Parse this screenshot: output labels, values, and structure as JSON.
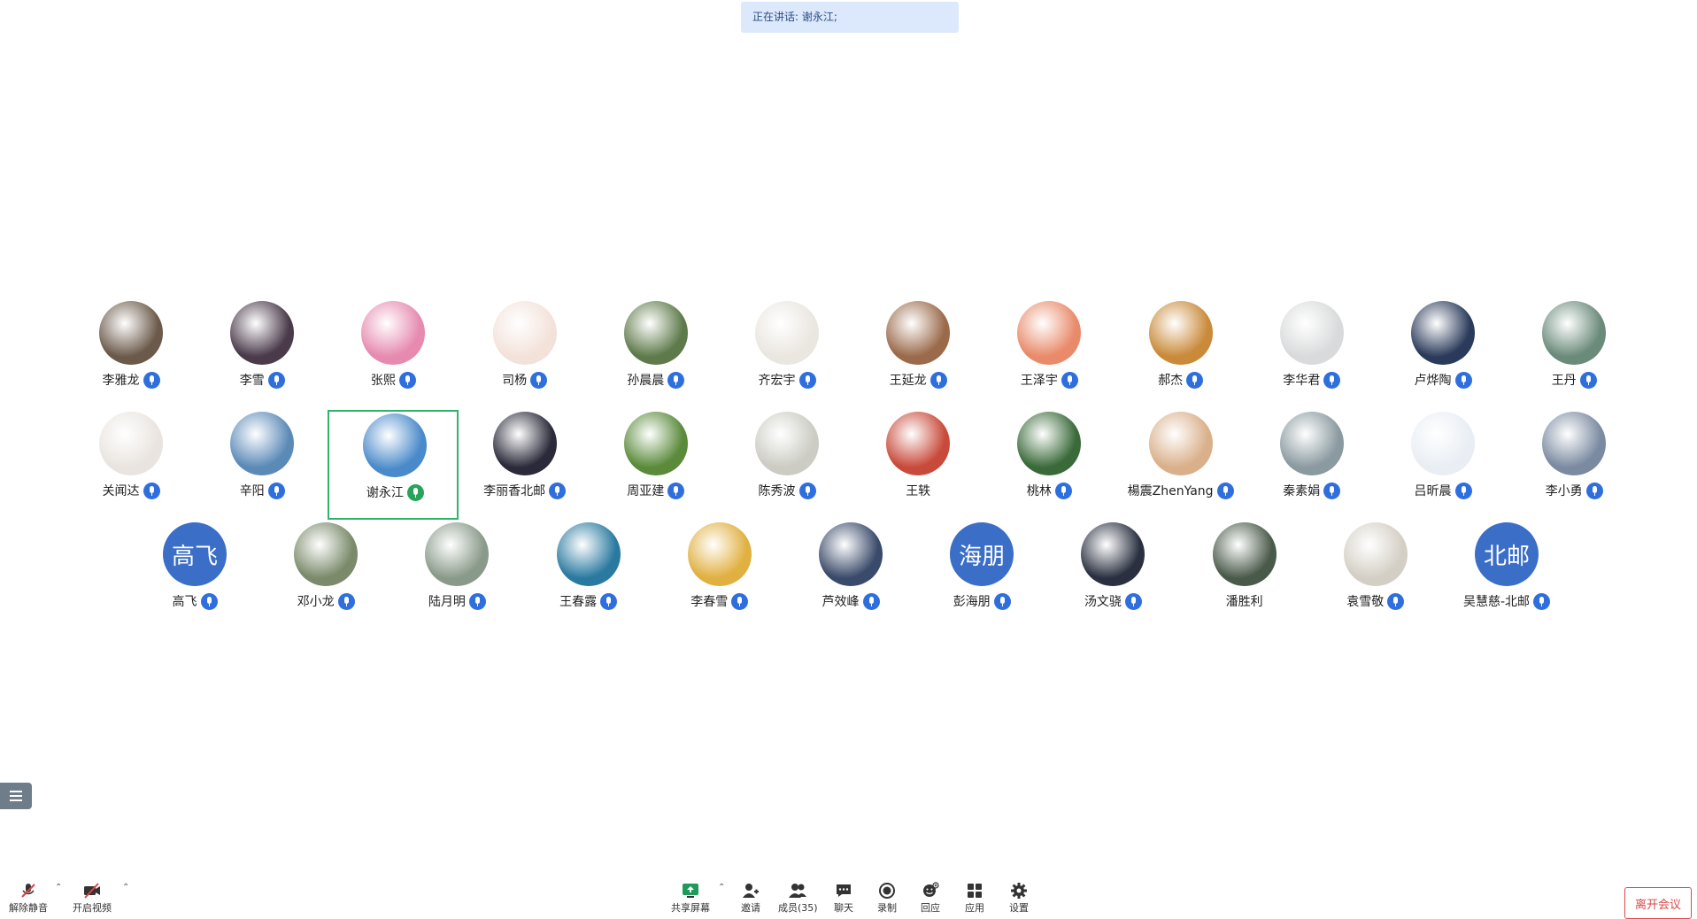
{
  "banner": {
    "speaking": "正在讲话: 谢永江;"
  },
  "participants": [
    {
      "name": "李雅龙",
      "avatar": "photo",
      "bg": "#6b5a4a"
    },
    {
      "name": "李雪",
      "avatar": "photo",
      "bg": "#4a3a4a"
    },
    {
      "name": "张熙",
      "avatar": "photo",
      "bg": "#e68ab0"
    },
    {
      "name": "司杨",
      "avatar": "photo",
      "bg": "#f3e2da"
    },
    {
      "name": "孙晨晨",
      "avatar": "photo",
      "bg": "#5e7a4a"
    },
    {
      "name": "齐宏宇",
      "avatar": "photo",
      "bg": "#eae6e0"
    },
    {
      "name": "王延龙",
      "avatar": "photo",
      "bg": "#9a6a4a"
    },
    {
      "name": "王泽宇",
      "avatar": "photo",
      "bg": "#e98a6a"
    },
    {
      "name": "郝杰",
      "avatar": "photo",
      "bg": "#c98a3a"
    },
    {
      "name": "李华君",
      "avatar": "photo",
      "bg": "#d9dadb"
    },
    {
      "name": "卢烨陶",
      "avatar": "photo",
      "bg": "#2a3a5a"
    },
    {
      "name": "王丹",
      "avatar": "photo",
      "bg": "#6a8a7a"
    },
    {
      "name": "关闻达",
      "avatar": "photo",
      "bg": "#e9e4df"
    },
    {
      "name": "辛阳",
      "avatar": "photo",
      "bg": "#5b8ab7"
    },
    {
      "name": "谢永江",
      "avatar": "photo",
      "bg": "#4a8aca",
      "speaking": true
    },
    {
      "name": "李丽香北邮",
      "avatar": "photo",
      "bg": "#2a2a3a"
    },
    {
      "name": "周亚建",
      "avatar": "photo",
      "bg": "#5a8a3a"
    },
    {
      "name": "陈秀波",
      "avatar": "photo",
      "bg": "#ccccc4"
    },
    {
      "name": "王轶",
      "avatar": "photo",
      "bg": "#c84a3a",
      "mic": false
    },
    {
      "name": "桃林",
      "avatar": "photo",
      "bg": "#3a6a3a"
    },
    {
      "name": "楊震ZhenYang",
      "avatar": "photo",
      "bg": "#d9b08a"
    },
    {
      "name": "秦素娟",
      "avatar": "photo",
      "bg": "#8a9aa0"
    },
    {
      "name": "吕昕晨",
      "avatar": "photo",
      "bg": "#e9eef4"
    },
    {
      "name": "李小勇",
      "avatar": "photo",
      "bg": "#7a8aa0"
    },
    {
      "name": "高飞",
      "avatar": "text",
      "initials": "高飞"
    },
    {
      "name": "邓小龙",
      "avatar": "photo",
      "bg": "#7a8a6a"
    },
    {
      "name": "陆月明",
      "avatar": "photo",
      "bg": "#8a9a8a"
    },
    {
      "name": "王春露",
      "avatar": "photo",
      "bg": "#2a7aa0"
    },
    {
      "name": "李春雪",
      "avatar": "photo",
      "bg": "#e0b040"
    },
    {
      "name": "芦效峰",
      "avatar": "photo",
      "bg": "#3a4a6a"
    },
    {
      "name": "彭海朋",
      "avatar": "text",
      "initials": "海朋"
    },
    {
      "name": "汤文骁",
      "avatar": "photo",
      "bg": "#2a3040"
    },
    {
      "name": "潘胜利",
      "avatar": "photo",
      "bg": "#4a5a4a",
      "mic": false
    },
    {
      "name": "袁雪敬",
      "avatar": "photo",
      "bg": "#d4cfc5"
    },
    {
      "name": "吴慧慈-北邮",
      "avatar": "text",
      "initials": "北邮"
    }
  ],
  "toolbar": {
    "unmute": "解除静音",
    "start_video": "开启视频",
    "share_screen": "共享屏幕",
    "invite": "邀请",
    "members": "成员(35)",
    "chat": "聊天",
    "record": "录制",
    "reaction": "回应",
    "apps": "应用",
    "settings": "设置",
    "leave": "离开会议"
  },
  "colors": {
    "accent": "#2f6fdd",
    "speaking": "#2fb36a",
    "leave": "#d84a4a",
    "banner": "#dce8fb"
  }
}
